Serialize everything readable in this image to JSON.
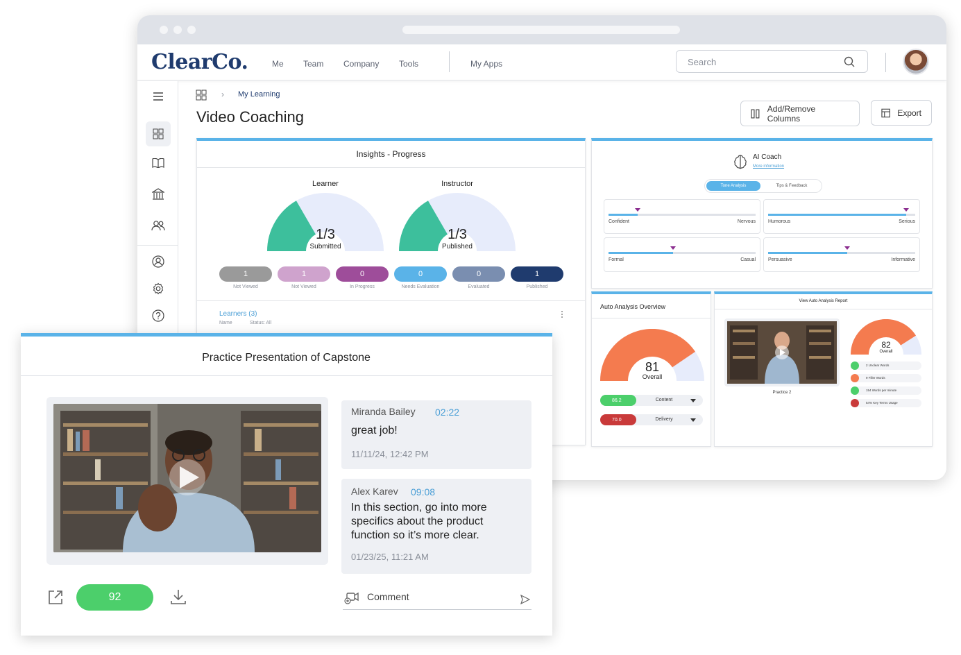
{
  "topnav": {
    "logo": "ClearCo.",
    "links": [
      "Me",
      "Team",
      "Company",
      "Tools",
      "My Apps"
    ],
    "search_placeholder": "Search"
  },
  "breadcrumb": {
    "current": "My Learning"
  },
  "page": {
    "title": "Video Coaching",
    "add_remove_columns": "Add/Remove Columns",
    "export": "Export"
  },
  "insights": {
    "title": "Insights - Progress",
    "learner": {
      "label": "Learner",
      "fraction": "1/3",
      "sub": "Submitted",
      "progress": 0.333
    },
    "instructor": {
      "label": "Instructor",
      "fraction": "1/3",
      "sub": "Published",
      "progress": 0.333
    },
    "status_pills": [
      {
        "value": "1",
        "label": "Not Viewed",
        "color": "#9a9a9a"
      },
      {
        "value": "1",
        "label": "Not Viewed",
        "color": "#cfa3cd"
      },
      {
        "value": "0",
        "label": "In Progress",
        "color": "#9e4d9a"
      },
      {
        "value": "0",
        "label": "Needs Evaluation",
        "color": "#5ab3e8"
      },
      {
        "value": "0",
        "label": "Evaluated",
        "color": "#7a8eb0"
      },
      {
        "value": "1",
        "label": "Published",
        "color": "#1f3b6e"
      }
    ],
    "learners_link": "Learners (3)",
    "filter_name": "Name",
    "filter_status": "Status: All"
  },
  "ai_coach": {
    "title": "AI Coach",
    "more_info": "More information",
    "tab_active": "Tone Analysis",
    "tab_inactive": "Tips & Feedback",
    "tones": [
      {
        "left": "Confident",
        "right": "Nervous",
        "level": 0.2
      },
      {
        "left": "Humorous",
        "right": "Serious",
        "level": 0.94
      },
      {
        "left": "Formal",
        "right": "Casual",
        "level": 0.44
      },
      {
        "left": "Persuasive",
        "right": "Informative",
        "level": 0.54
      }
    ]
  },
  "auto_analysis": {
    "title": "Auto Analysis Overview",
    "overall_score": "81",
    "overall_label": "Overall",
    "overall_progress": 0.81,
    "rows": [
      {
        "value": "86.2",
        "label": "Content",
        "color": "#4ccf6b"
      },
      {
        "value": "70.0",
        "label": "Delivery",
        "color": "#c93a3a"
      }
    ]
  },
  "report": {
    "title": "View Auto Analysis Report",
    "thumb_label": "Practice 2",
    "overall_score": "82",
    "overall_label": "Overall",
    "overall_progress": 0.82,
    "metrics": [
      {
        "text": "2 Unclear Words",
        "color": "#4ccf6b"
      },
      {
        "text": "9 Filler Words",
        "color": "#f47b4f"
      },
      {
        "text": "154 Words per minute",
        "color": "#4ccf6b"
      },
      {
        "text": "54% Key Terms Usage",
        "color": "#c93a3a"
      }
    ]
  },
  "practice": {
    "title": "Practice Presentation of Capstone",
    "score": "92",
    "comments": [
      {
        "name": "Miranda Bailey",
        "time": "02:22",
        "text": "great job!",
        "date": "11/11/24, 12:42 PM"
      },
      {
        "name": "Alex Karev",
        "time": "09:08",
        "text": "In this section, go into more specifics about the product function so it’s more clear.",
        "date": "01/23/25, 11:21 AM"
      }
    ],
    "comment_placeholder": "Comment"
  },
  "colors": {
    "accent_blue": "#5ab3e8",
    "brand_navy": "#1f3b6e",
    "teal": "#3dbf9c",
    "orange": "#f47b4f",
    "green": "#4ccf6b"
  },
  "icons": [
    "search-icon",
    "menu-icon",
    "dashboard-icon",
    "book-icon",
    "bank-icon",
    "users-icon",
    "profile-icon",
    "settings-icon",
    "help-icon",
    "columns-icon",
    "export-icon",
    "brain-icon",
    "play-icon",
    "external-link-icon",
    "download-icon",
    "add-video-icon",
    "send-icon",
    "more-icon"
  ]
}
